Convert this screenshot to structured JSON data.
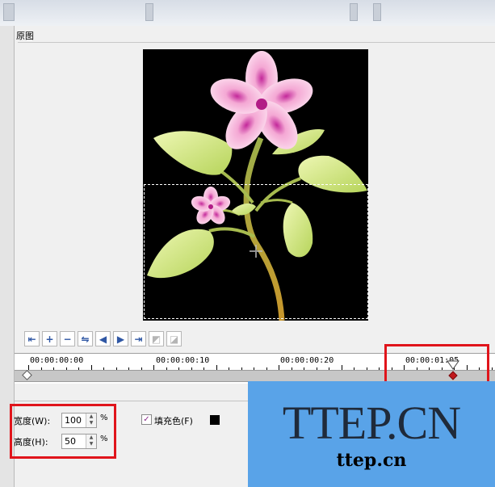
{
  "section": {
    "title": "原图"
  },
  "toolbar": {
    "buttons": [
      {
        "name": "goto-start",
        "glyph": "⇤"
      },
      {
        "name": "add-keyframe",
        "glyph": "+"
      },
      {
        "name": "remove-keyframe",
        "glyph": "−"
      },
      {
        "name": "reverse-keyframes",
        "glyph": "⇋"
      },
      {
        "name": "prev-keyframe",
        "glyph": "◀"
      },
      {
        "name": "next-keyframe",
        "glyph": "▶"
      },
      {
        "name": "goto-end",
        "glyph": "⇥"
      },
      {
        "name": "copy-keyframe",
        "glyph": "◩"
      },
      {
        "name": "paste-keyframe",
        "glyph": "◪"
      }
    ]
  },
  "timeline": {
    "labels": [
      "00:00:00:00",
      "00:00:00:10",
      "00:00:00:20",
      "00:00:01:05"
    ]
  },
  "properties": {
    "width": {
      "label": "宽度(W):",
      "value": "100",
      "unit": "%"
    },
    "height": {
      "label": "高度(H):",
      "value": "50",
      "unit": "%"
    },
    "fill": {
      "label": "填充色(F)",
      "checked": true,
      "color": "#000000"
    }
  },
  "watermark": {
    "big": "TTEP.CN",
    "small": "ttep.cn"
  },
  "colors": {
    "highlight": "#e0141b",
    "watermark_bg": "#59a3e8",
    "keyframe": "#c0181c"
  }
}
